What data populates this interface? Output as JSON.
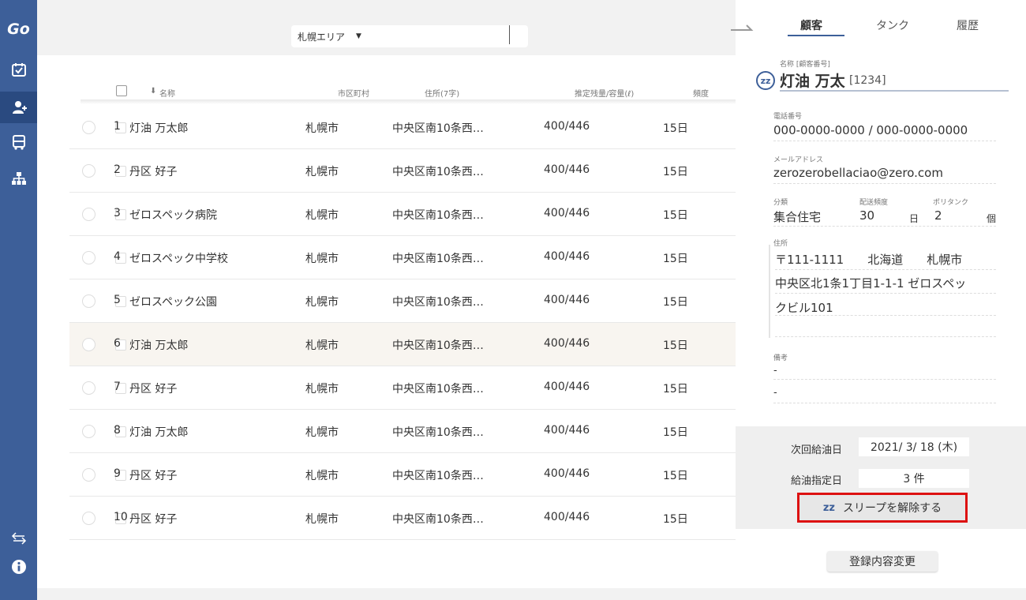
{
  "sidebar": {
    "logo": "Go",
    "nav_icons": [
      "calendar-check-icon",
      "customer-icon",
      "truck-icon",
      "org-chart-icon",
      "swap-arrows-icon",
      "info-icon"
    ],
    "accent_color": "#3d5f99"
  },
  "toolbar": {
    "area_select": "札幌エリア",
    "caret": "▼"
  },
  "table": {
    "headers": {
      "name": "名称",
      "city": "市区町村",
      "address": "住所(7字)",
      "remaining": "推定残量/容量(ℓ)",
      "frequency": "頻度"
    },
    "sort_arrow": "⬇",
    "rows": [
      {
        "no": "1",
        "name": "灯油 万太郎",
        "city": "札幌市",
        "address": "中央区南10条西…",
        "remaining": "400/446",
        "frequency": "15日"
      },
      {
        "no": "2",
        "name": "丹区 好子",
        "city": "札幌市",
        "address": "中央区南10条西…",
        "remaining": "400/446",
        "frequency": "15日"
      },
      {
        "no": "3",
        "name": "ゼロスペック病院",
        "city": "札幌市",
        "address": "中央区南10条西…",
        "remaining": "400/446",
        "frequency": "15日"
      },
      {
        "no": "4",
        "name": "ゼロスペック中学校",
        "city": "札幌市",
        "address": "中央区南10条西…",
        "remaining": "400/446",
        "frequency": "15日"
      },
      {
        "no": "5",
        "name": "ゼロスペック公園",
        "city": "札幌市",
        "address": "中央区南10条西…",
        "remaining": "400/446",
        "frequency": "15日"
      },
      {
        "no": "6",
        "name": "灯油 万太郎",
        "city": "札幌市",
        "address": "中央区南10条西…",
        "remaining": "400/446",
        "frequency": "15日"
      },
      {
        "no": "7",
        "name": "丹区 好子",
        "city": "札幌市",
        "address": "中央区南10条西…",
        "remaining": "400/446",
        "frequency": "15日"
      },
      {
        "no": "8",
        "name": "灯油 万太郎",
        "city": "札幌市",
        "address": "中央区南10条西…",
        "remaining": "400/446",
        "frequency": "15日"
      },
      {
        "no": "9",
        "name": "丹区 好子",
        "city": "札幌市",
        "address": "中央区南10条西…",
        "remaining": "400/446",
        "frequency": "15日"
      },
      {
        "no": "10",
        "name": "丹区 好子",
        "city": "札幌市",
        "address": "中央区南10条西…",
        "remaining": "400/446",
        "frequency": "15日"
      }
    ]
  },
  "panel": {
    "tabs": [
      "顧客",
      "タンク",
      "履歴"
    ],
    "name_label": "名称 [顧客番号]",
    "name": "灯油 万太",
    "customer_no": "[1234]",
    "sleep_glyph": "zz",
    "phone_label": "電話番号",
    "phone": "000-0000-0000 / 000-0000-0000",
    "email_label": "メールアドレス",
    "email": "zerozerobellaciao@zero.com",
    "category_label": "分類",
    "category": "集合住宅",
    "freq_label": "配送頻度",
    "freq_value": "30",
    "freq_unit": "日",
    "tank_label": "ポリタンク",
    "tank_value": "2",
    "tank_unit": "個",
    "address_label": "住所",
    "address_line1": "〒111-1111　　北海道　　札幌市",
    "address_line2": "中央区北1条1丁目1-1-1 ゼロスペッ",
    "address_line3": "クビル101",
    "notes_label": "備考",
    "notes_line1": "-",
    "notes_line2": "-",
    "next_date_label": "次回給油日",
    "next_date": "2021/ 3/ 18 (木)",
    "designated_label": "給油指定日",
    "designated_count": "3 件",
    "sleep_button": "スリープを解除する",
    "edit_button": "登録内容変更",
    "highlight_color": "#dd1111"
  }
}
